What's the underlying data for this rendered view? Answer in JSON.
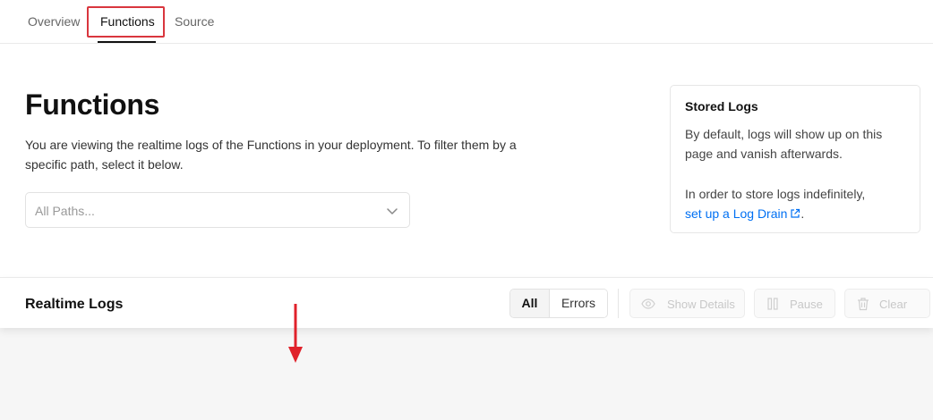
{
  "tabs": {
    "overview": "Overview",
    "functions": "Functions",
    "source": "Source"
  },
  "main": {
    "title": "Functions",
    "description": "You are viewing the realtime logs of the Functions in your deployment. To filter them by a specific path, select it below.",
    "path_select": {
      "placeholder": "All Paths..."
    }
  },
  "stored_logs": {
    "title": "Stored Logs",
    "text1": "By default, logs will show up on this page and vanish afterwards.",
    "text2_prefix": "In order to store logs indefinitely,",
    "link": "set up a Log Drain",
    "text2_suffix": "."
  },
  "realtime_logs": {
    "title": "Realtime Logs",
    "filter_all": "All",
    "filter_errors": "Errors",
    "show_details": "Show Details",
    "pause": "Pause",
    "clear": "Clear"
  },
  "colors": {
    "link": "#0070f3",
    "highlight": "#d9363e",
    "annotation_arrow": "#e0222b"
  },
  "icons": [
    "chevron-down-icon",
    "external-link-icon",
    "eye-icon",
    "pause-icon",
    "trash-icon",
    "arrow-down-icon"
  ]
}
